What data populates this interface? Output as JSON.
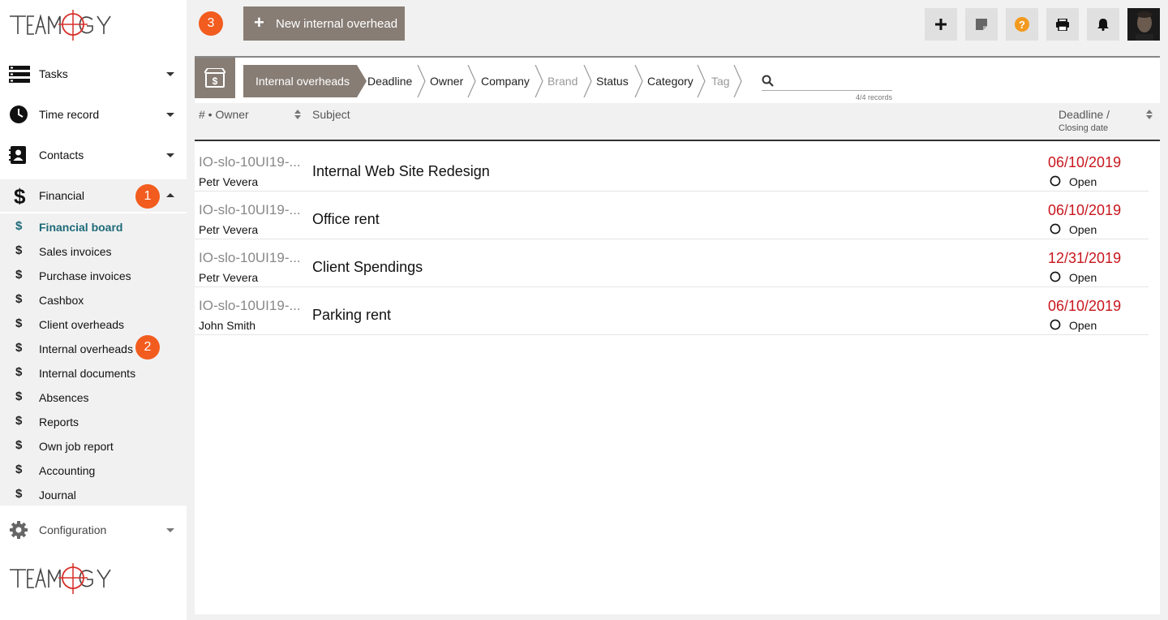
{
  "brand": {
    "logo_text": "TEAMOGY",
    "accent": "#f25c1e",
    "muted": "#877d75"
  },
  "sidebar": {
    "items": [
      {
        "label": "Tasks",
        "icon": "tasks-icon"
      },
      {
        "label": "Time record",
        "icon": "clock-icon"
      },
      {
        "label": "Contacts",
        "icon": "contacts-icon"
      },
      {
        "label": "Financial",
        "icon": "dollar-icon"
      }
    ],
    "financial_sub": [
      {
        "label": "Financial board"
      },
      {
        "label": "Sales invoices"
      },
      {
        "label": "Purchase invoices"
      },
      {
        "label": "Cashbox"
      },
      {
        "label": "Client overheads"
      },
      {
        "label": "Internal overheads"
      },
      {
        "label": "Internal documents"
      },
      {
        "label": "Absences"
      },
      {
        "label": "Reports"
      },
      {
        "label": "Own job report"
      },
      {
        "label": "Accounting"
      },
      {
        "label": "Journal"
      }
    ],
    "configuration": {
      "label": "Configuration",
      "icon": "gear-icon"
    }
  },
  "badges": {
    "b1": "1",
    "b2": "2",
    "b3": "3"
  },
  "toolbar": {
    "new_label": "New internal overhead",
    "buttons": [
      "plus-icon",
      "note-icon",
      "help-icon",
      "print-icon",
      "bell-icon"
    ]
  },
  "filters": {
    "crumbs": [
      "Internal overheads",
      "Deadline",
      "Owner",
      "Company",
      "Brand",
      "Status",
      "Category",
      "Tag"
    ],
    "search_value": "",
    "records": "4/4 records"
  },
  "table": {
    "col_owner": "# • Owner",
    "col_subject": "Subject",
    "col_deadline_1": "Deadline /",
    "col_deadline_2": "Closing date",
    "rows": [
      {
        "code": "IO-slo-10UI19-...",
        "owner": "Petr Vevera",
        "subject": "Internal Web Site Redesign",
        "deadline": "06/10/2019",
        "status": "Open"
      },
      {
        "code": "IO-slo-10UI19-...",
        "owner": "Petr Vevera",
        "subject": "Office rent",
        "deadline": "06/10/2019",
        "status": "Open"
      },
      {
        "code": "IO-slo-10UI19-...",
        "owner": "Petr Vevera",
        "subject": "Client Spendings",
        "deadline": "12/31/2019",
        "status": "Open"
      },
      {
        "code": "IO-slo-10UI19-...",
        "owner": "John Smith",
        "subject": "Parking rent",
        "deadline": "06/10/2019",
        "status": "Open"
      }
    ]
  }
}
